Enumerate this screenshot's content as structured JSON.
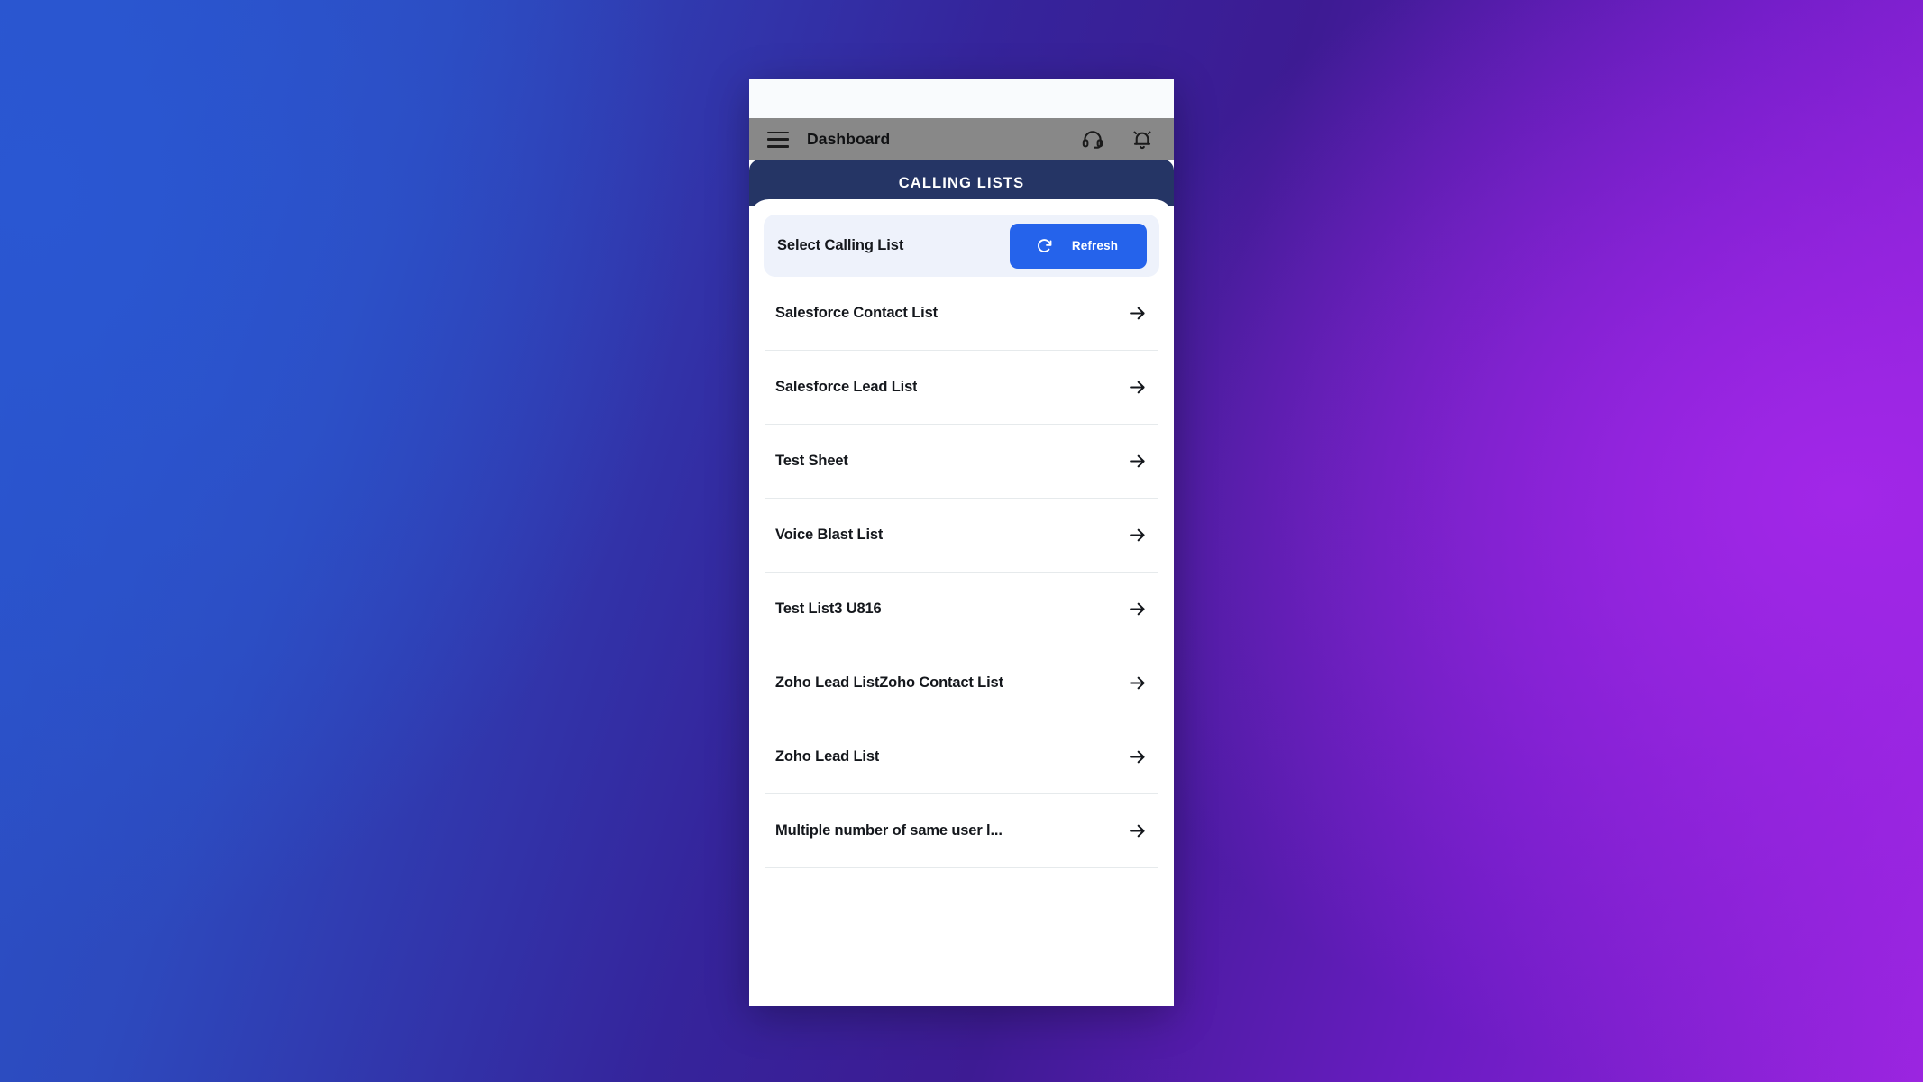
{
  "status_bar": {
    "left_text": "",
    "right_text": ""
  },
  "app_bar": {
    "menu_icon": "hamburger-menu-icon",
    "title": "Dashboard",
    "support_icon": "headset-icon",
    "notification_icon": "bell-icon"
  },
  "section_header": {
    "title": "CALLING LISTS"
  },
  "select_bar": {
    "label": "Select Calling List",
    "refresh_label": "Refresh",
    "refresh_icon": "refresh-icon",
    "background": "#eef2fb",
    "button_color": "#2563eb"
  },
  "calling_lists": [
    {
      "label": "Salesforce Contact List"
    },
    {
      "label": "Salesforce Lead List"
    },
    {
      "label": "Test Sheet"
    },
    {
      "label": "Voice Blast List"
    },
    {
      "label": "Test List3 U816"
    },
    {
      "label": "Zoho Lead ListZoho Contact List"
    },
    {
      "label": "Zoho Lead List"
    },
    {
      "label": "Multiple number of same user l..."
    }
  ],
  "colors": {
    "header_navy": "#253565",
    "app_bar_gray": "#888888",
    "accent_blue": "#2563eb",
    "text_dark": "#14171c",
    "divider": "#e6eaec"
  }
}
